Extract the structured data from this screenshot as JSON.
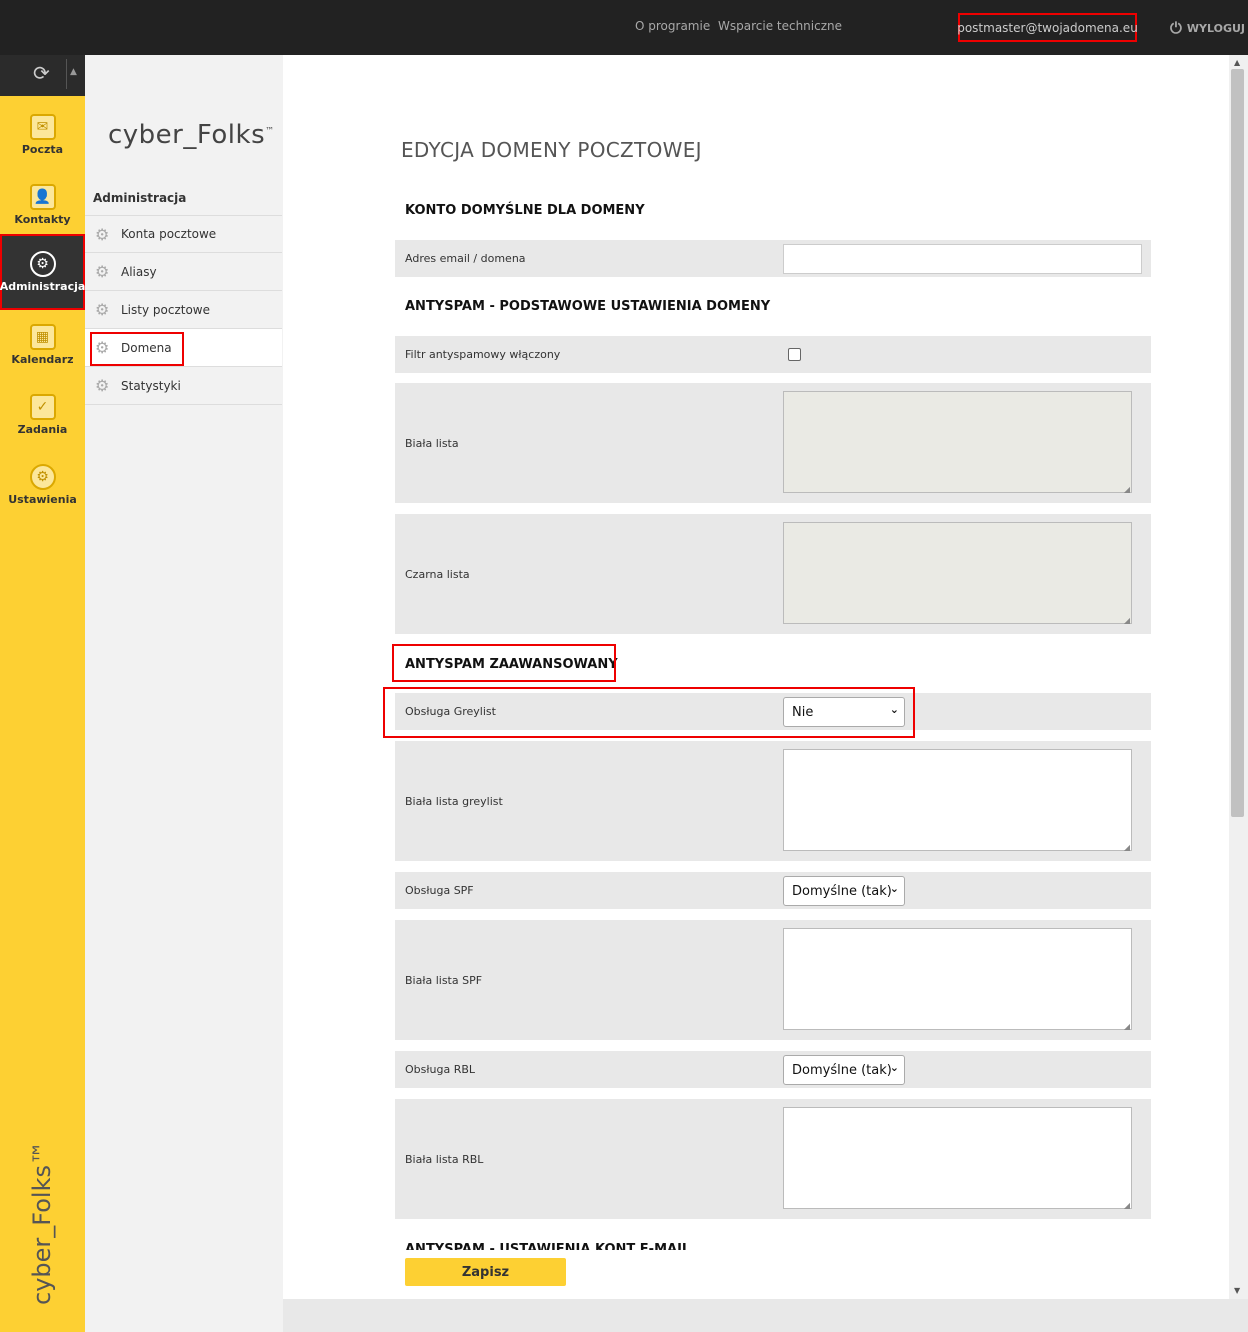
{
  "header": {
    "about": "O programie",
    "support": "Wsparcie techniczne",
    "user": "postmaster@twojadomena.eu",
    "logout": "WYLOGUJ"
  },
  "taskbar": {
    "items": [
      {
        "label": "Poczta",
        "icon": "mail-icon"
      },
      {
        "label": "Kontakty",
        "icon": "contacts-icon"
      },
      {
        "label": "Administracja",
        "icon": "admin-gear-icon"
      },
      {
        "label": "Kalendarz",
        "icon": "calendar-icon"
      },
      {
        "label": "Zadania",
        "icon": "tasks-icon"
      },
      {
        "label": "Ustawienia",
        "icon": "settings-icon"
      }
    ],
    "logo": "cyber_Folks™"
  },
  "subnav": {
    "brand": "cyber_Folks",
    "brand_tm": "™",
    "title": "Administracja",
    "items": [
      {
        "label": "Konta pocztowe"
      },
      {
        "label": "Aliasy"
      },
      {
        "label": "Listy pocztowe"
      },
      {
        "label": "Domena"
      },
      {
        "label": "Statystyki"
      }
    ]
  },
  "main": {
    "title": "EDYCJA DOMENY POCZTOWEJ",
    "section_default": "KONTO DOMYŚLNE DLA DOMENY",
    "label_email": "Adres email / domena",
    "section_basic": "ANTYSPAM - PODSTAWOWE USTAWIENIA DOMENY",
    "label_filter": "Filtr antyspamowy włączony",
    "label_whitelist": "Biała lista",
    "label_blacklist": "Czarna lista",
    "section_advanced": "ANTYSPAM ZAAWANSOWANY",
    "label_greylist": "Obsługa Greylist",
    "greylist_value": "Nie",
    "label_greylist_white": "Biała lista greylist",
    "label_spf": "Obsługa SPF",
    "spf_value": "Domyślne (tak)",
    "label_spf_white": "Biała lista SPF",
    "label_rbl": "Obsługa RBL",
    "rbl_value": "Domyślne (tak)",
    "label_rbl_white": "Biała lista RBL",
    "section_accounts": "ANTYSPAM - USTAWIENIA KONT E-MAIL",
    "save": "Zapisz"
  }
}
